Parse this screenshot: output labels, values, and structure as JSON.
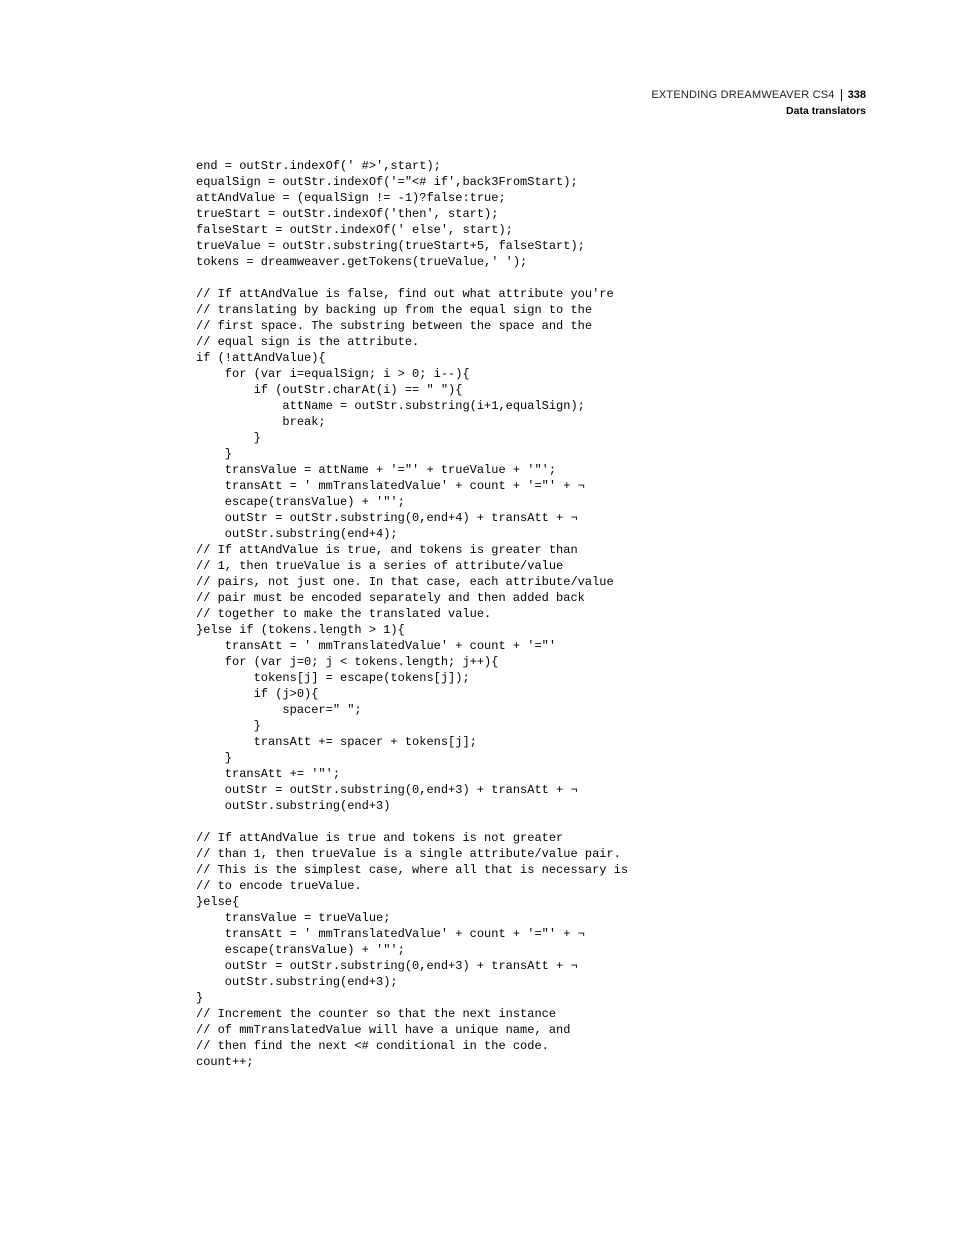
{
  "header": {
    "title": "EXTENDING DREAMWEAVER CS4",
    "page_number": "338",
    "subtitle": "Data translators"
  },
  "code": "end = outStr.indexOf(' #>',start);\nequalSign = outStr.indexOf('=\"<# if',back3FromStart);\nattAndValue = (equalSign != -1)?false:true;\ntrueStart = outStr.indexOf('then', start);\nfalseStart = outStr.indexOf(' else', start);\ntrueValue = outStr.substring(trueStart+5, falseStart);\ntokens = dreamweaver.getTokens(trueValue,' ');\n\n// If attAndValue is false, find out what attribute you're\n// translating by backing up from the equal sign to the\n// first space. The substring between the space and the\n// equal sign is the attribute.\nif (!attAndValue){\n    for (var i=equalSign; i > 0; i--){\n        if (outStr.charAt(i) == \" \"){\n            attName = outStr.substring(i+1,equalSign);\n            break;\n        }\n    }\n    transValue = attName + '=\"' + trueValue + '\"';\n    transAtt = ' mmTranslatedValue' + count + '=\"' + ¬\n    escape(transValue) + '\"';\n    outStr = outStr.substring(0,end+4) + transAtt + ¬\n    outStr.substring(end+4);\n// If attAndValue is true, and tokens is greater than\n// 1, then trueValue is a series of attribute/value\n// pairs, not just one. In that case, each attribute/value\n// pair must be encoded separately and then added back\n// together to make the translated value.\n}else if (tokens.length > 1){\n    transAtt = ' mmTranslatedValue' + count + '=\"'\n    for (var j=0; j < tokens.length; j++){\n        tokens[j] = escape(tokens[j]);\n        if (j>0){\n            spacer=\" \";\n        }\n        transAtt += spacer + tokens[j];\n    }\n    transAtt += '\"';\n    outStr = outStr.substring(0,end+3) + transAtt + ¬\n    outStr.substring(end+3)\n\n// If attAndValue is true and tokens is not greater\n// than 1, then trueValue is a single attribute/value pair.\n// This is the simplest case, where all that is necessary is\n// to encode trueValue.\n}else{\n    transValue = trueValue;\n    transAtt = ' mmTranslatedValue' + count + '=\"' + ¬\n    escape(transValue) + '\"';\n    outStr = outStr.substring(0,end+3) + transAtt + ¬\n    outStr.substring(end+3);\n}\n// Increment the counter so that the next instance\n// of mmTranslatedValue will have a unique name, and\n// then find the next <# conditional in the code.\ncount++;"
}
